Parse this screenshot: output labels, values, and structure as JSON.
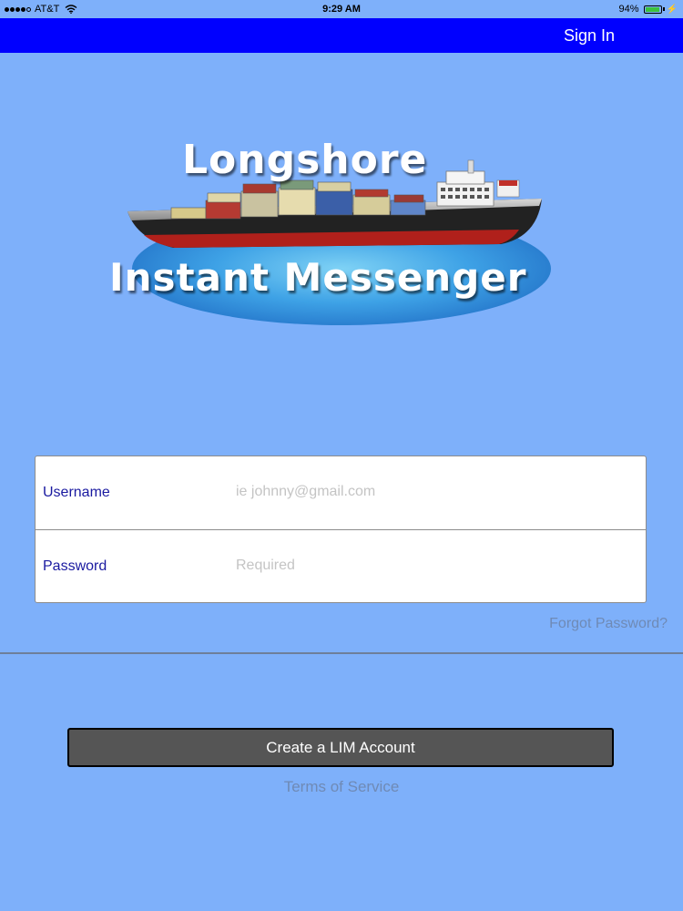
{
  "status_bar": {
    "carrier": "AT&T",
    "time": "9:29 AM",
    "battery_percent": "94%",
    "battery_level": 0.94,
    "signal_icon": "signal-dots-icon",
    "wifi_icon": "wifi-icon",
    "battery_icon": "battery-icon",
    "charging_icon": "bolt-icon"
  },
  "nav_bar": {
    "sign_in_label": "Sign In",
    "background_color": "#0000ff"
  },
  "logo": {
    "line1": "Longshore",
    "line2": "Instant Messenger",
    "icon": "container-ship-logo"
  },
  "form": {
    "username": {
      "label": "Username",
      "placeholder": "ie johnny@gmail.com",
      "value": ""
    },
    "password": {
      "label": "Password",
      "placeholder": "Required",
      "value": ""
    }
  },
  "forgot_password_label": "Forgot Password?",
  "create_account_label": "Create a LIM Account",
  "terms_label": "Terms of Service",
  "colors": {
    "background": "#7eb0fa",
    "nav": "#0000ff",
    "label_text": "#1a1aa0",
    "link_text": "#6f8ab5",
    "button": "#555555"
  }
}
